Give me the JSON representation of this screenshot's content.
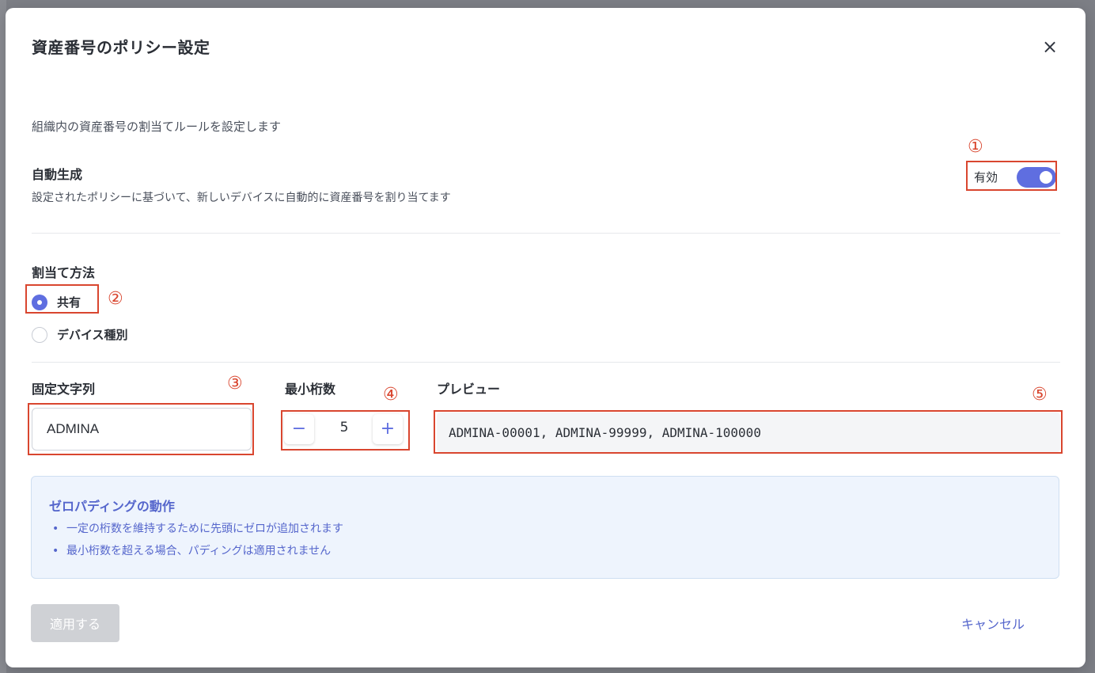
{
  "modal": {
    "title": "資産番号のポリシー設定",
    "close_icon": "×",
    "description": "組織内の資産番号の割当てルールを設定します"
  },
  "auto_generation": {
    "title": "自動生成",
    "description": "設定されたポリシーに基づいて、新しいデバイスに自動的に資産番号を割り当てます",
    "toggle_label": "有効",
    "enabled": true
  },
  "assignment": {
    "title": "割当て方法",
    "options": [
      {
        "label": "共有",
        "selected": true
      },
      {
        "label": "デバイス種別",
        "selected": false
      }
    ]
  },
  "fixed_string": {
    "label": "固定文字列",
    "value": "ADMINA"
  },
  "min_digits": {
    "label": "最小桁数",
    "value": "5",
    "decrement_icon": "−",
    "increment_icon": "+"
  },
  "preview": {
    "label": "プレビュー",
    "value": "ADMINA-00001, ADMINA-99999, ADMINA-100000"
  },
  "zero_padding": {
    "title": "ゼロパディングの動作",
    "items": [
      "一定の桁数を維持するために先頭にゼロが追加されます",
      "最小桁数を超える場合、パディングは適用されません"
    ]
  },
  "footer": {
    "apply_label": "適用する",
    "cancel_label": "キャンセル"
  },
  "annotations": [
    "①",
    "②",
    "③",
    "④",
    "⑤"
  ],
  "colors": {
    "accent": "#5f6ee0",
    "annotation": "#d9462f",
    "info_text": "#5566cc",
    "info_bg": "#eef4fd"
  }
}
